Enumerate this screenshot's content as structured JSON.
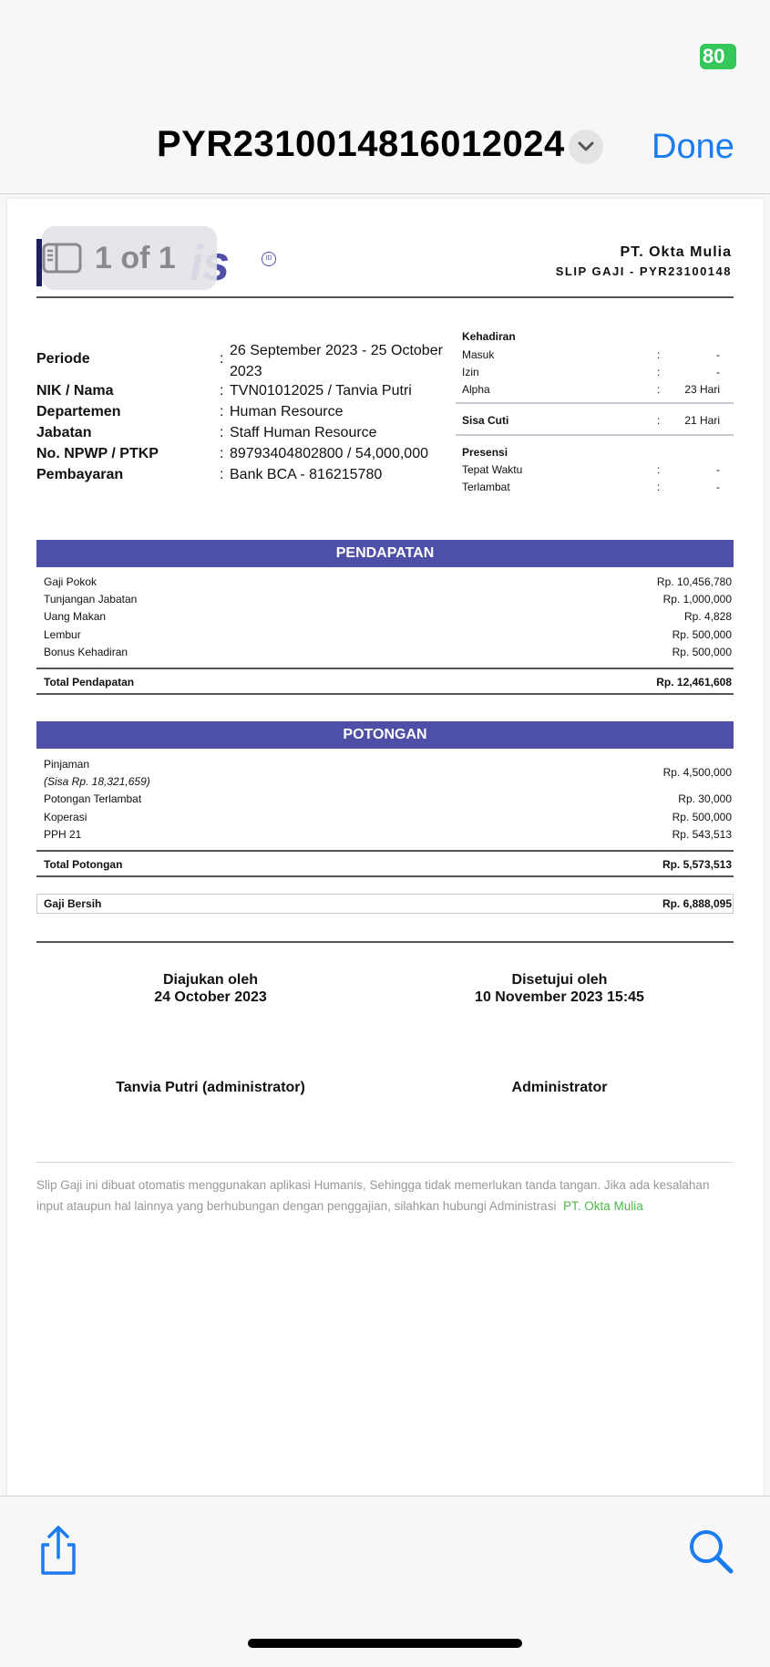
{
  "status": {
    "battery": "80"
  },
  "nav": {
    "title": "PYR2310014816012024",
    "done_label": "Done",
    "page_indicator": "1 of 1"
  },
  "icons": {
    "menu_chevron": "chevron-down-icon",
    "page_sidebar": "sidebar-icon",
    "share": "share-icon",
    "search": "search-icon"
  },
  "colors": {
    "accent": "#1a7cf0",
    "band": "#4e4fa6",
    "battery": "#34c759",
    "footer_link": "#4cb84c"
  },
  "slip": {
    "logo_text": "is",
    "logo_badge": "ID",
    "company": "PT. Okta Mulia",
    "slip_id": "SLIP GAJI - PYR23100148",
    "employee": [
      {
        "label": "Periode",
        "value": "26 September 2023 - 25 October 2023"
      },
      {
        "label": "NIK / Nama",
        "value": "TVN01012025 / Tanvia Putri"
      },
      {
        "label": "Departemen",
        "value": "Human Resource"
      },
      {
        "label": "Jabatan",
        "value": "Staff Human Resource"
      },
      {
        "label": "No. NPWP / PTKP",
        "value": "89793404802800 / 54,000,000"
      },
      {
        "label": "Pembayaran",
        "value": "Bank BCA - 816215780"
      }
    ],
    "kehadiran": {
      "heading": "Kehadiran",
      "rows": [
        {
          "label": "Masuk",
          "value": "-"
        },
        {
          "label": "Izin",
          "value": "-"
        },
        {
          "label": "Alpha",
          "value": "23 Hari"
        }
      ]
    },
    "sisa_cuti": {
      "label": "Sisa Cuti",
      "value": "21 Hari"
    },
    "presensi": {
      "heading": "Presensi",
      "rows": [
        {
          "label": "Tepat Waktu",
          "value": "-"
        },
        {
          "label": "Terlambat",
          "value": "-"
        }
      ]
    },
    "pendapatan": {
      "heading": "PENDAPATAN",
      "rows": [
        {
          "label": "Gaji Pokok",
          "value": "Rp. 10,456,780"
        },
        {
          "label": "Tunjangan Jabatan",
          "value": "Rp. 1,000,000"
        },
        {
          "label": "Uang Makan",
          "value": "Rp. 4,828"
        },
        {
          "label": "Lembur",
          "value": "Rp. 500,000"
        },
        {
          "label": "Bonus Kehadiran",
          "value": "Rp. 500,000"
        }
      ],
      "total_label": "Total Pendapatan",
      "total_value": "Rp. 12,461,608"
    },
    "potongan": {
      "heading": "POTONGAN",
      "rows": [
        {
          "label": "Pinjaman",
          "sub": "(Sisa Rp. 18,321,659)",
          "value": "Rp. 4,500,000"
        },
        {
          "label": "Potongan Terlambat",
          "value": "Rp. 30,000"
        },
        {
          "label": "Koperasi",
          "value": "Rp. 500,000"
        },
        {
          "label": "PPH 21",
          "value": "Rp. 543,513"
        }
      ],
      "total_label": "Total Potongan",
      "total_value": "Rp. 5,573,513"
    },
    "gaji_bersih": {
      "label": "Gaji Bersih",
      "value": "Rp. 6,888,095"
    },
    "signatures": {
      "submitted_title": "Diajukan oleh",
      "submitted_date": "24 October 2023",
      "submitted_name": "Tanvia Putri (administrator)",
      "approved_title": "Disetujui oleh",
      "approved_date": "10 November 2023 15:45",
      "approved_name": "Administrator"
    },
    "footer": {
      "note": "Slip Gaji ini dibuat otomatis menggunakan aplikasi Humanis, Sehingga tidak memerlukan tanda tangan. Jika ada kesalahan input ataupun hal lainnya yang berhubungan dengan penggajian, silahkan hubungi Administrasi",
      "link": "PT. Okta Mulia"
    }
  }
}
